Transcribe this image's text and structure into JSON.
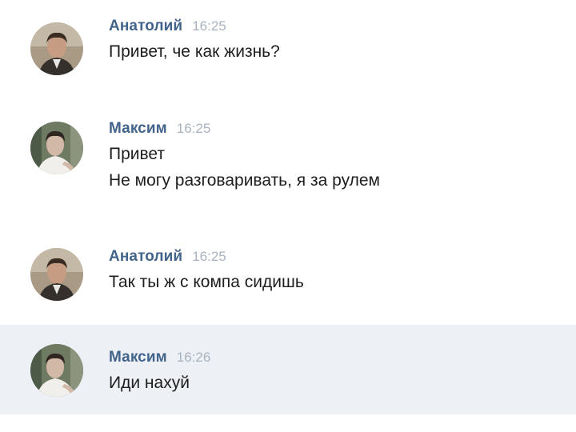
{
  "messages": [
    {
      "author": "Анатолий",
      "time": "16:25",
      "avatar_icon": "user-avatar-anatoly",
      "lines": [
        "Привет, че как жизнь?"
      ]
    },
    {
      "author": "Максим",
      "time": "16:25",
      "avatar_icon": "user-avatar-maxim",
      "lines": [
        "Привет",
        "Не могу разговаривать, я за рулем"
      ]
    },
    {
      "author": "Анатолий",
      "time": "16:25",
      "avatar_icon": "user-avatar-anatoly",
      "lines": [
        "Так ты ж с компа сидишь"
      ]
    },
    {
      "author": "Максим",
      "time": "16:26",
      "avatar_icon": "user-avatar-maxim",
      "highlighted": true,
      "lines": [
        "Иди нахуй"
      ]
    }
  ],
  "colors": {
    "author": "#42648b",
    "time": "#a9b3bf",
    "text": "#1e1e1e",
    "highlight_background": "#edf0f5"
  }
}
